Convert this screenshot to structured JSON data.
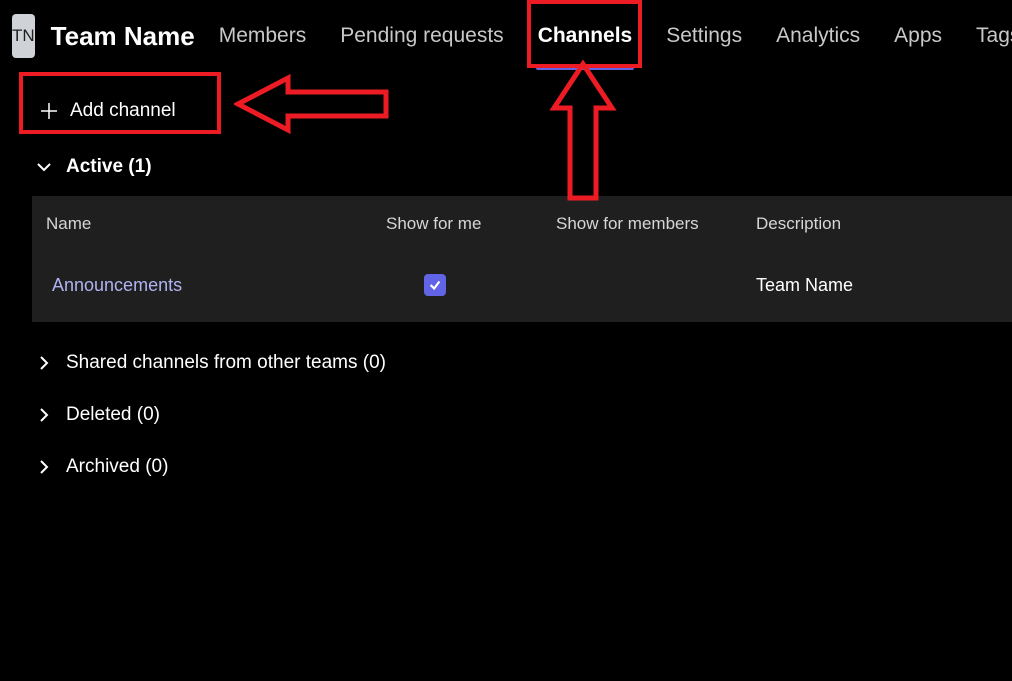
{
  "header": {
    "avatar_initials": "TN",
    "team_title": "Team Name",
    "tabs": [
      {
        "label": "Members",
        "active": false
      },
      {
        "label": "Pending requests",
        "active": false
      },
      {
        "label": "Channels",
        "active": true
      },
      {
        "label": "Settings",
        "active": false
      },
      {
        "label": "Analytics",
        "active": false
      },
      {
        "label": "Apps",
        "active": false
      },
      {
        "label": "Tags",
        "active": false
      }
    ]
  },
  "add_channel_label": "Add channel",
  "sections": {
    "active": {
      "label": "Active (1)",
      "columns": {
        "name": "Name",
        "show_for_me": "Show for me",
        "show_for_members": "Show for members",
        "description": "Description"
      },
      "rows": [
        {
          "name": "Announcements",
          "show_for_me": true,
          "show_for_members": "",
          "description": "Team Name"
        }
      ]
    },
    "shared": {
      "label": "Shared channels from other teams (0)"
    },
    "deleted": {
      "label": "Deleted (0)"
    },
    "archived": {
      "label": "Archived (0)"
    }
  },
  "annotations": {
    "highlight_color": "#ed1c24"
  }
}
